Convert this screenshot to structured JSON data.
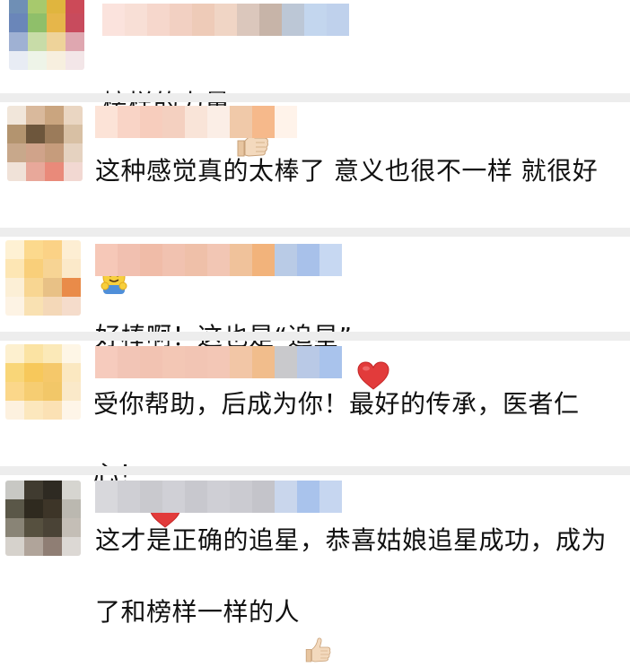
{
  "comments": [
    {
      "text": "榜样的力量",
      "emoji": "thumbs-up-emoji",
      "avatar": [
        "#6f8fb5",
        "#a7c96d",
        "#e0b53e",
        "#cc4a58",
        "#6a86b9",
        "#8fbf6a",
        "#e6b64a",
        "#c84b5d",
        "#9fb1d3",
        "#c8dca8",
        "#eed39a",
        "#dfa7b0",
        "#e8ecf4",
        "#eef4e8",
        "#f7efdf",
        "#f3e6e8"
      ],
      "name": [
        "#fbe3dd",
        "#f8dfd6",
        "#f6d7cc",
        "#f2d0c2",
        "#eecbb8",
        "#f0d5c5",
        "#dbc7bc",
        "#c7b4a8",
        "#bcc7d6",
        "#c3d6ee",
        "#bfd1ec"
      ]
    },
    {
      "text": "这种感觉真的太棒了 意义也很不一样 就很好",
      "emoji": "hugging-face-emoji",
      "avatar": [
        "#f1e6da",
        "#d9b99c",
        "#caa57f",
        "#ead6c2",
        "#b3946f",
        "#6d563c",
        "#9b7b5a",
        "#d8c0a4",
        "#c8a88b",
        "#d0a38a",
        "#c69c7c",
        "#e5d2c0",
        "#f0e2d8",
        "#e8a89a",
        "#e98a7a",
        "#f2d8d2"
      ],
      "name": [
        "#fce3d7",
        "#f9d4c6",
        "#f7cdbd",
        "#f4d0c0",
        "#f9e4d8",
        "#fbeee6",
        "#f0c9a9",
        "#f6b98b",
        "#fff3ea"
      ]
    },
    {
      "text": "好棒啊！这也是“追星”",
      "emoji": "red-heart-emoji",
      "avatar": [
        "#fef1d3",
        "#fcd98d",
        "#fbd286",
        "#fdeed3",
        "#fde6b4",
        "#f9cf7a",
        "#f7d494",
        "#fbe9c9",
        "#fcefd6",
        "#f8d692",
        "#e8c186",
        "#e98b49",
        "#fdf3e4",
        "#f9e1b2",
        "#f4d8b8",
        "#f5dccb"
      ],
      "name": [
        "#f6c8b8",
        "#f1c0b0",
        "#f0bca8",
        "#f1c2b0",
        "#efc0a9",
        "#f2c6b4",
        "#f0c29b",
        "#f2b37b",
        "#b9cbe6",
        "#a8c1ea",
        "#c7d8f2"
      ]
    },
    {
      "text": "受你帮助，后成为你！最好的传承，医者仁心！",
      "emoji": "red-heart-emoji",
      "avatar": [
        "#fdf0cf",
        "#fbe3a3",
        "#fbe9b8",
        "#fef6e6",
        "#f9d678",
        "#f7c85b",
        "#f5c86a",
        "#fbe8c1",
        "#fbd78a",
        "#f6cd72",
        "#f2c768",
        "#fae9c9",
        "#fdf1df",
        "#fce7bd",
        "#fbe1b4",
        "#fef5e8"
      ],
      "name": [
        "#f6cbbd",
        "#f2c5b6",
        "#f2c3b2",
        "#f3c7b5",
        "#f2c5b4",
        "#f3c7b6",
        "#f2c6a6",
        "#f1bd8c",
        "#c9c9cc",
        "#b9c9e6",
        "#a9c3ec"
      ]
    },
    {
      "text": "这才是正确的追星，恭喜姑娘追星成功，成为了和榜样一样的人",
      "emoji": "thumbs-up-emoji",
      "avatar": [
        "#c8c8c4",
        "#403b30",
        "#2e2a22",
        "#d6d5d0",
        "#5a5748",
        "#2f2a1f",
        "#3d3528",
        "#bbb8b0",
        "#898476",
        "#56503f",
        "#4a4336",
        "#c4beb6",
        "#d6d2cc",
        "#b0a49a",
        "#8f7e74",
        "#dcd8d4"
      ],
      "name": [
        "#d8d8dc",
        "#cfcfd4",
        "#c9c9ce",
        "#d0d0d6",
        "#c8c8ce",
        "#cfcfd5",
        "#cbcbd1",
        "#c4c4ca",
        "#c9d6ec",
        "#a9c3ec",
        "#c6d6f0"
      ]
    }
  ]
}
